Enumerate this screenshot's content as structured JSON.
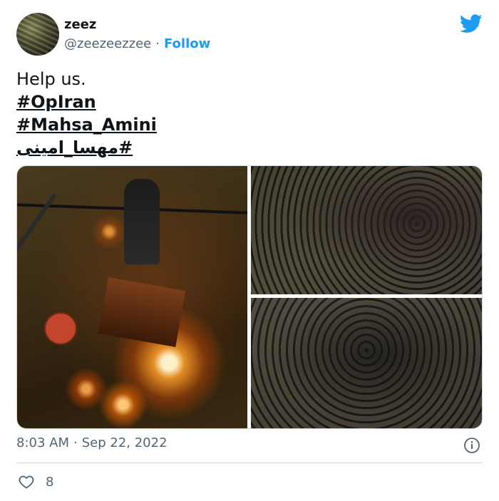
{
  "author": {
    "name": "zeez",
    "handle": "@zeezeezzee",
    "separator": "·",
    "follow_label": "Follow"
  },
  "tweet": {
    "lines": [
      "Help us.",
      "#OpIran",
      "#Mahsa_Amini",
      "#مهسا_امینی"
    ]
  },
  "meta": {
    "time": "8:03 AM",
    "separator": "·",
    "date": "Sep 22, 2022"
  },
  "actions": {
    "like_count": "8"
  },
  "icons": {
    "brand": "twitter-bird-icon",
    "info": "info-icon",
    "like": "heart-icon"
  },
  "colors": {
    "accent": "#1d9bf0",
    "text": "#0f1419",
    "secondary": "#536471",
    "border": "#cfd9de"
  }
}
